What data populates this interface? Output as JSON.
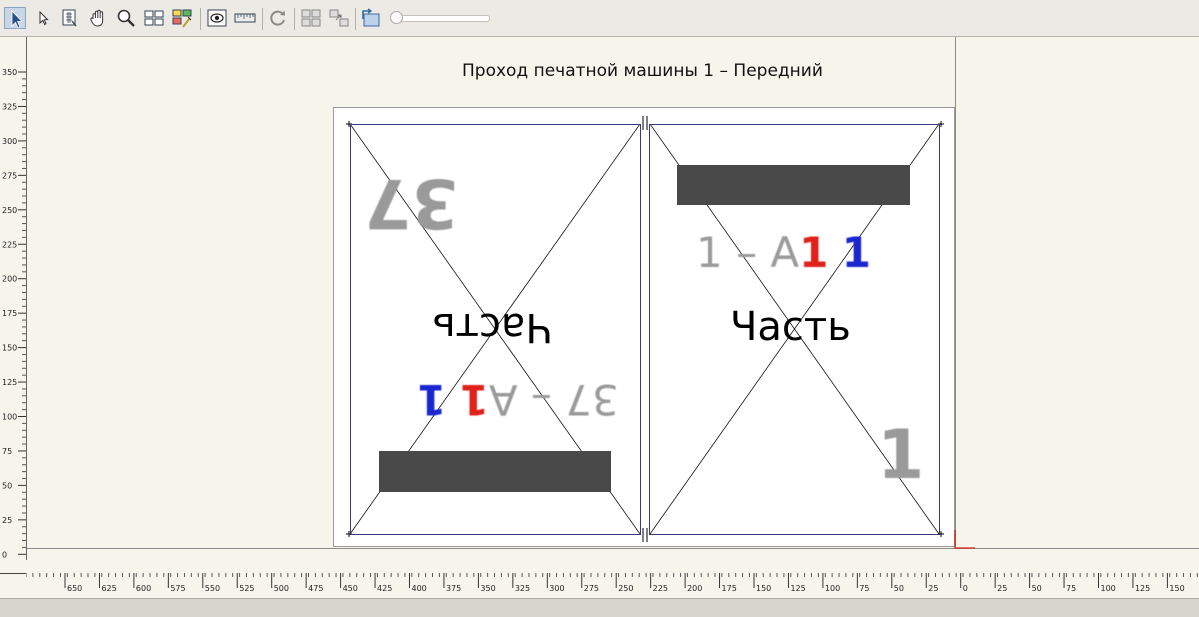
{
  "toolbar": {
    "icons": [
      "select-arrow-icon",
      "pointer-icon",
      "page-grid-icon",
      "hand-icon",
      "zoom-icon",
      "layout-icon",
      "color-layout-icon",
      "eye-icon",
      "ruler-icon",
      "rotate-icon",
      "panel-icon-1",
      "panel-icon-2",
      "fit-icon"
    ],
    "zoom_slider_value": 0
  },
  "page": {
    "title": "Проход печатной машины 1 – Передний"
  },
  "left_panel": {
    "number": "37",
    "part_label": "Часть",
    "code_prefix": "37 – A",
    "code_red": "1",
    "code_blue": "1"
  },
  "right_panel": {
    "number": "1",
    "part_label": "Часть",
    "code_prefix": "1 – A",
    "code_red": "1",
    "code_blue": "1"
  },
  "rulers": {
    "vertical_labels": [
      "350",
      "325",
      "300",
      "275",
      "250",
      "225",
      "200",
      "175",
      "150",
      "125",
      "100",
      "75",
      "50",
      "25",
      "0"
    ],
    "horizontal_labels": [
      "650",
      "625",
      "600",
      "575",
      "550",
      "525",
      "500",
      "475",
      "450",
      "425",
      "400",
      "375",
      "350",
      "325",
      "300",
      "275",
      "250",
      "225",
      "200",
      "175",
      "150",
      "125",
      "100",
      "75",
      "50",
      "25",
      "0",
      "25",
      "50",
      "75",
      "100",
      "125",
      "150"
    ]
  },
  "colors": {
    "red": "#e0221a",
    "blue": "#1a26d0",
    "bar": "#494949",
    "background": "#f6f5ec"
  }
}
